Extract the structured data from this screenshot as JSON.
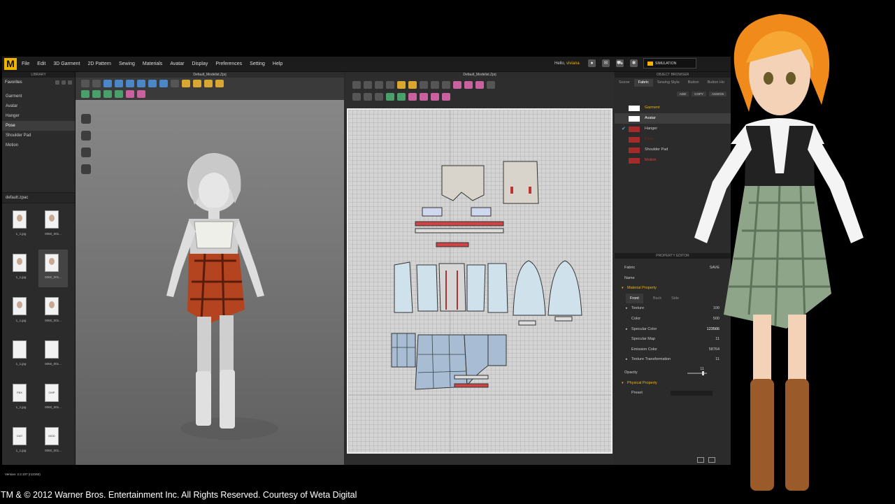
{
  "menubar": {
    "logo": "M",
    "items": [
      "File",
      "Edit",
      "3D Garment",
      "2D Pattern",
      "Sewing",
      "Materials",
      "Avatar",
      "Display",
      "Preferences",
      "Setting",
      "Help"
    ],
    "greeting": "Hello,",
    "username": "viviana",
    "simulation_label": "SIMULATION",
    "icons": [
      "user-icon",
      "chat-icon",
      "cart-icon",
      "gear-icon",
      "help-icon"
    ]
  },
  "library": {
    "title": "LIBRARY",
    "favorites_label": "Favorites",
    "items": [
      {
        "label": "Garment",
        "selected": false
      },
      {
        "label": "Avatar",
        "selected": false
      },
      {
        "label": "Hanger",
        "selected": false
      },
      {
        "label": "Pose",
        "selected": true
      },
      {
        "label": "Shoulder Pad",
        "selected": false
      },
      {
        "label": "Motion",
        "selected": false
      }
    ],
    "file_name": "default.zpac",
    "thumbnails": [
      {
        "caption": "1_1.jpg",
        "kind": "face"
      },
      {
        "caption": "0060_001...",
        "kind": "face"
      },
      {
        "caption": "1_1.jpg",
        "kind": "face"
      },
      {
        "caption": "0060_001...",
        "kind": "face",
        "selected": true
      },
      {
        "caption": "1_1.jpg",
        "kind": "face"
      },
      {
        "caption": "0060_001...",
        "kind": "face"
      },
      {
        "caption": "1_1.jpg",
        "kind": "blank"
      },
      {
        "caption": "0060_001...",
        "kind": "blank"
      },
      {
        "caption": "1_1.jpg",
        "kind": "FBX"
      },
      {
        "caption": "0060_001...",
        "kind": "CMP"
      },
      {
        "caption": "1_1.jpg",
        "kind": "CMT"
      },
      {
        "caption": "0060_001...",
        "kind": "MOD"
      }
    ],
    "version": "Version: 2.2.107 (r12192)"
  },
  "viewport3d": {
    "title": "Default_Modelist.Zprj"
  },
  "viewport2d": {
    "title": "Default_Modelist.Zprj"
  },
  "object_browser": {
    "title": "OBJECT BROWSER",
    "tabs": [
      {
        "label": "Scene",
        "selected": false
      },
      {
        "label": "Fabric",
        "selected": true
      },
      {
        "label": "Sewing Style",
        "selected": false
      },
      {
        "label": "Button",
        "selected": false
      },
      {
        "label": "Button Ho",
        "selected": false
      }
    ],
    "actions": [
      "ADD",
      "COPY",
      "ASSIGN"
    ],
    "fabrics": [
      {
        "name": "Garment",
        "color": "#ffffff",
        "text_color": "#f0b400",
        "checked": false,
        "selected": false
      },
      {
        "name": "Avatar",
        "color": "#ffffff",
        "text_color": "#ffffff",
        "checked": false,
        "selected": true
      },
      {
        "name": "Hanger",
        "color": "#a52a2a",
        "text_color": "#cccccc",
        "checked": true,
        "selected": false
      },
      {
        "name": "Pose",
        "color": "#a52a2a",
        "text_color": "#6a2a2a",
        "checked": false,
        "selected": false
      },
      {
        "name": "Shoulder Pad",
        "color": "#a52a2a",
        "text_color": "#cccccc",
        "checked": false,
        "selected": false
      },
      {
        "name": "Motion",
        "color": "#a52a2a",
        "text_color": "#e04040",
        "checked": false,
        "selected": false
      }
    ]
  },
  "property_editor": {
    "title": "PROPERTY EDITOR",
    "fabric_label": "Fabric",
    "save_label": "SAVE",
    "name_label": "Name",
    "material_header": "Material Property",
    "subtabs": [
      {
        "label": "Front",
        "selected": true
      },
      {
        "label": "Back",
        "selected": false
      },
      {
        "label": "Side",
        "selected": false
      }
    ],
    "texture": {
      "label": "Texture",
      "value": "100"
    },
    "color": {
      "label": "Color",
      "value": "500"
    },
    "specular_color": {
      "label": "Specular Color",
      "value": "123566"
    },
    "specular_map": {
      "label": "Specular Map",
      "value": "11"
    },
    "emission_color": {
      "label": "Emission Color",
      "value": "58764"
    },
    "texture_transformation": {
      "label": "Texture Transformation",
      "value": "11"
    },
    "opacity": {
      "label": "Opacity",
      "value": "11",
      "level": 0.75
    },
    "physical_header": "Physical Property",
    "preset_label": "Preset"
  },
  "copyright": "TM & © 2012 Warner Bros. Entertainment Inc. All Rights Reserved. Courtesy of Weta Digital",
  "colors": {
    "accent": "#f0b400",
    "plaid_red": "#b4441f",
    "plaid_green": "#8fa58a",
    "pattern_blue": "#c9dce8"
  }
}
